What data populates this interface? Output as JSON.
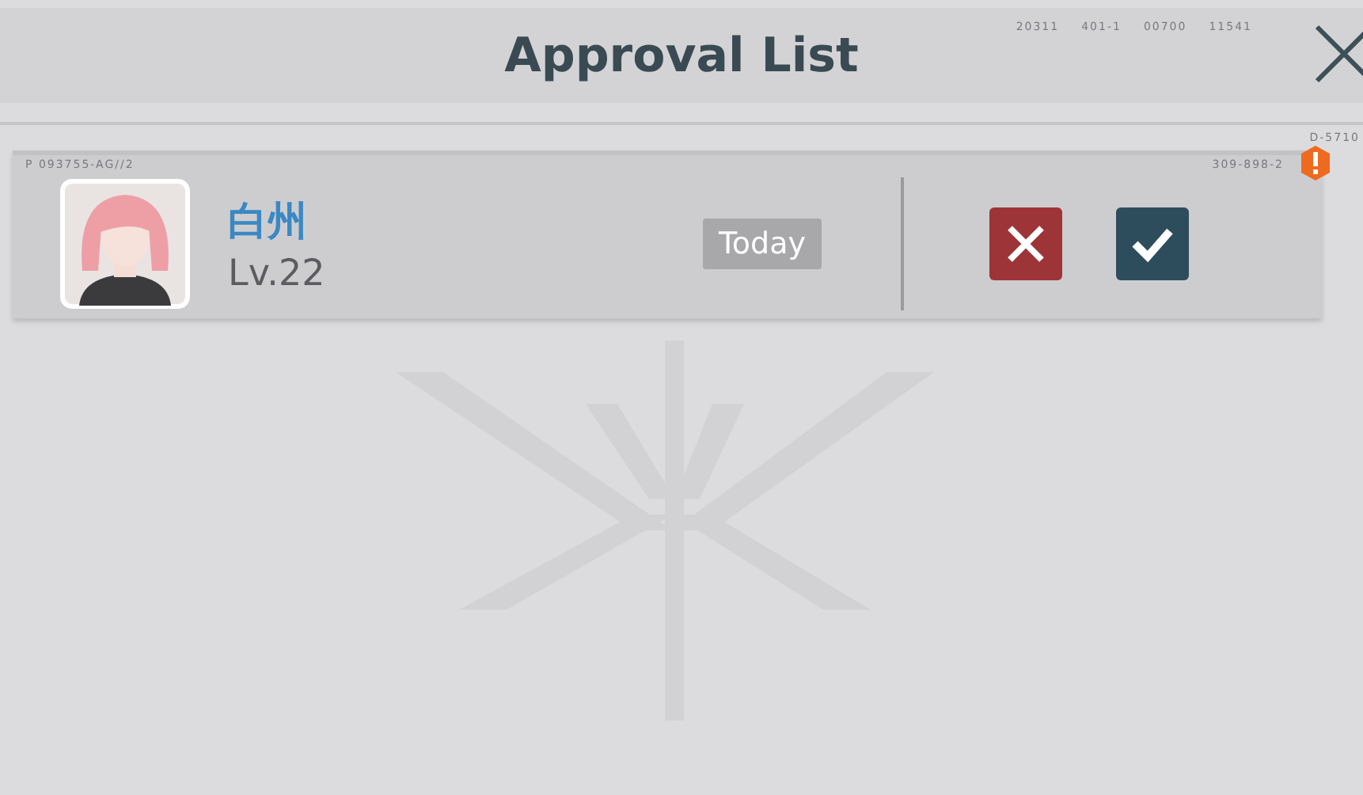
{
  "header": {
    "title": "Approval List",
    "codes": [
      "20311",
      "401-1",
      "00700",
      "11541"
    ]
  },
  "corner_code": "D-5710",
  "requests": [
    {
      "card_code": "P 093755-AG//2",
      "serial": "309-898-2",
      "name": "白州",
      "level": "Lv.22",
      "date": "Today",
      "alert": true
    }
  ]
}
